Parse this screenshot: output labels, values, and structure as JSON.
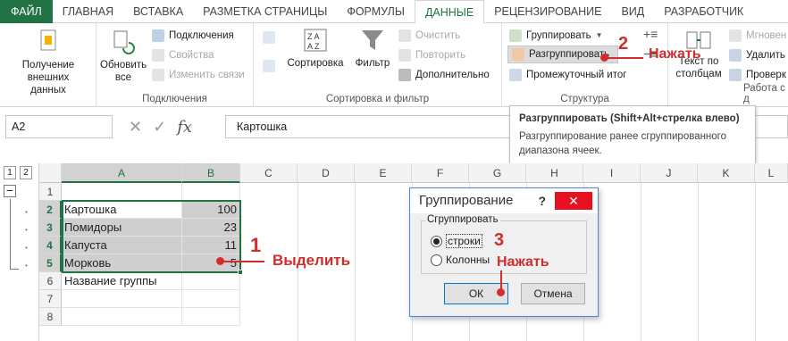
{
  "ribbon_tabs": [
    "ФАЙЛ",
    "ГЛАВНАЯ",
    "ВСТАВКА",
    "РАЗМЕТКА СТРАНИЦЫ",
    "ФОРМУЛЫ",
    "ДАННЫЕ",
    "РЕЦЕНЗИРОВАНИЕ",
    "ВИД",
    "РАЗРАБОТЧИК"
  ],
  "active_tab": "ДАННЫЕ",
  "ribbon": {
    "get_external": "Получение внешних данных",
    "refresh_all": "Обновить все",
    "connections": "Подключения",
    "properties": "Свойства",
    "edit_links": "Изменить связи",
    "connections_group": "Подключения",
    "sort": "Сортировка",
    "filter": "Фильтр",
    "clear": "Очистить",
    "reapply": "Повторить",
    "advanced": "Дополнительно",
    "sort_filter_group": "Сортировка и фильтр",
    "group": "Группировать",
    "ungroup": "Разгруппировать",
    "subtotal": "Промежуточный итог",
    "outline_group": "Структура",
    "text_to_columns": "Текст по столбцам",
    "flash_fill": "Мгновен",
    "remove_dup": "Удалить д",
    "validation": "Проверк",
    "data_tools_group": "Работа с д"
  },
  "name_box": "A2",
  "formula": "Картошка",
  "tooltip": {
    "title": "Разгруппировать (Shift+Alt+стрелка влево)",
    "body": "Разгруппирование ранее сгруппированного диапазона ячеек."
  },
  "outline_levels": [
    "1",
    "2"
  ],
  "columns": [
    "A",
    "B",
    "C",
    "D",
    "E",
    "F",
    "G",
    "H",
    "I",
    "J",
    "K",
    "L"
  ],
  "rows": [
    {
      "n": "1",
      "a": "",
      "b": ""
    },
    {
      "n": "2",
      "a": "Картошка",
      "b": "100"
    },
    {
      "n": "3",
      "a": "Помидоры",
      "b": "23"
    },
    {
      "n": "4",
      "a": "Капуста",
      "b": "11"
    },
    {
      "n": "5",
      "a": "Морковь",
      "b": "5"
    },
    {
      "n": "6",
      "a": "Название группы",
      "b": ""
    },
    {
      "n": "7",
      "a": "",
      "b": ""
    },
    {
      "n": "8",
      "a": "",
      "b": ""
    }
  ],
  "dialog": {
    "title": "Группирование",
    "help": "?",
    "close": "✕",
    "legend": "Сгруппировать",
    "opt_rows": "строки",
    "opt_cols": "Колонны",
    "ok": "ОК",
    "cancel": "Отмена"
  },
  "annotations": {
    "n1": "1",
    "t1": "Выделить",
    "n2": "2",
    "t2": "Нажать",
    "n3": "3",
    "t3": "Нажать"
  },
  "colors": {
    "accent": "#217346",
    "annotation": "#d22d2d"
  }
}
